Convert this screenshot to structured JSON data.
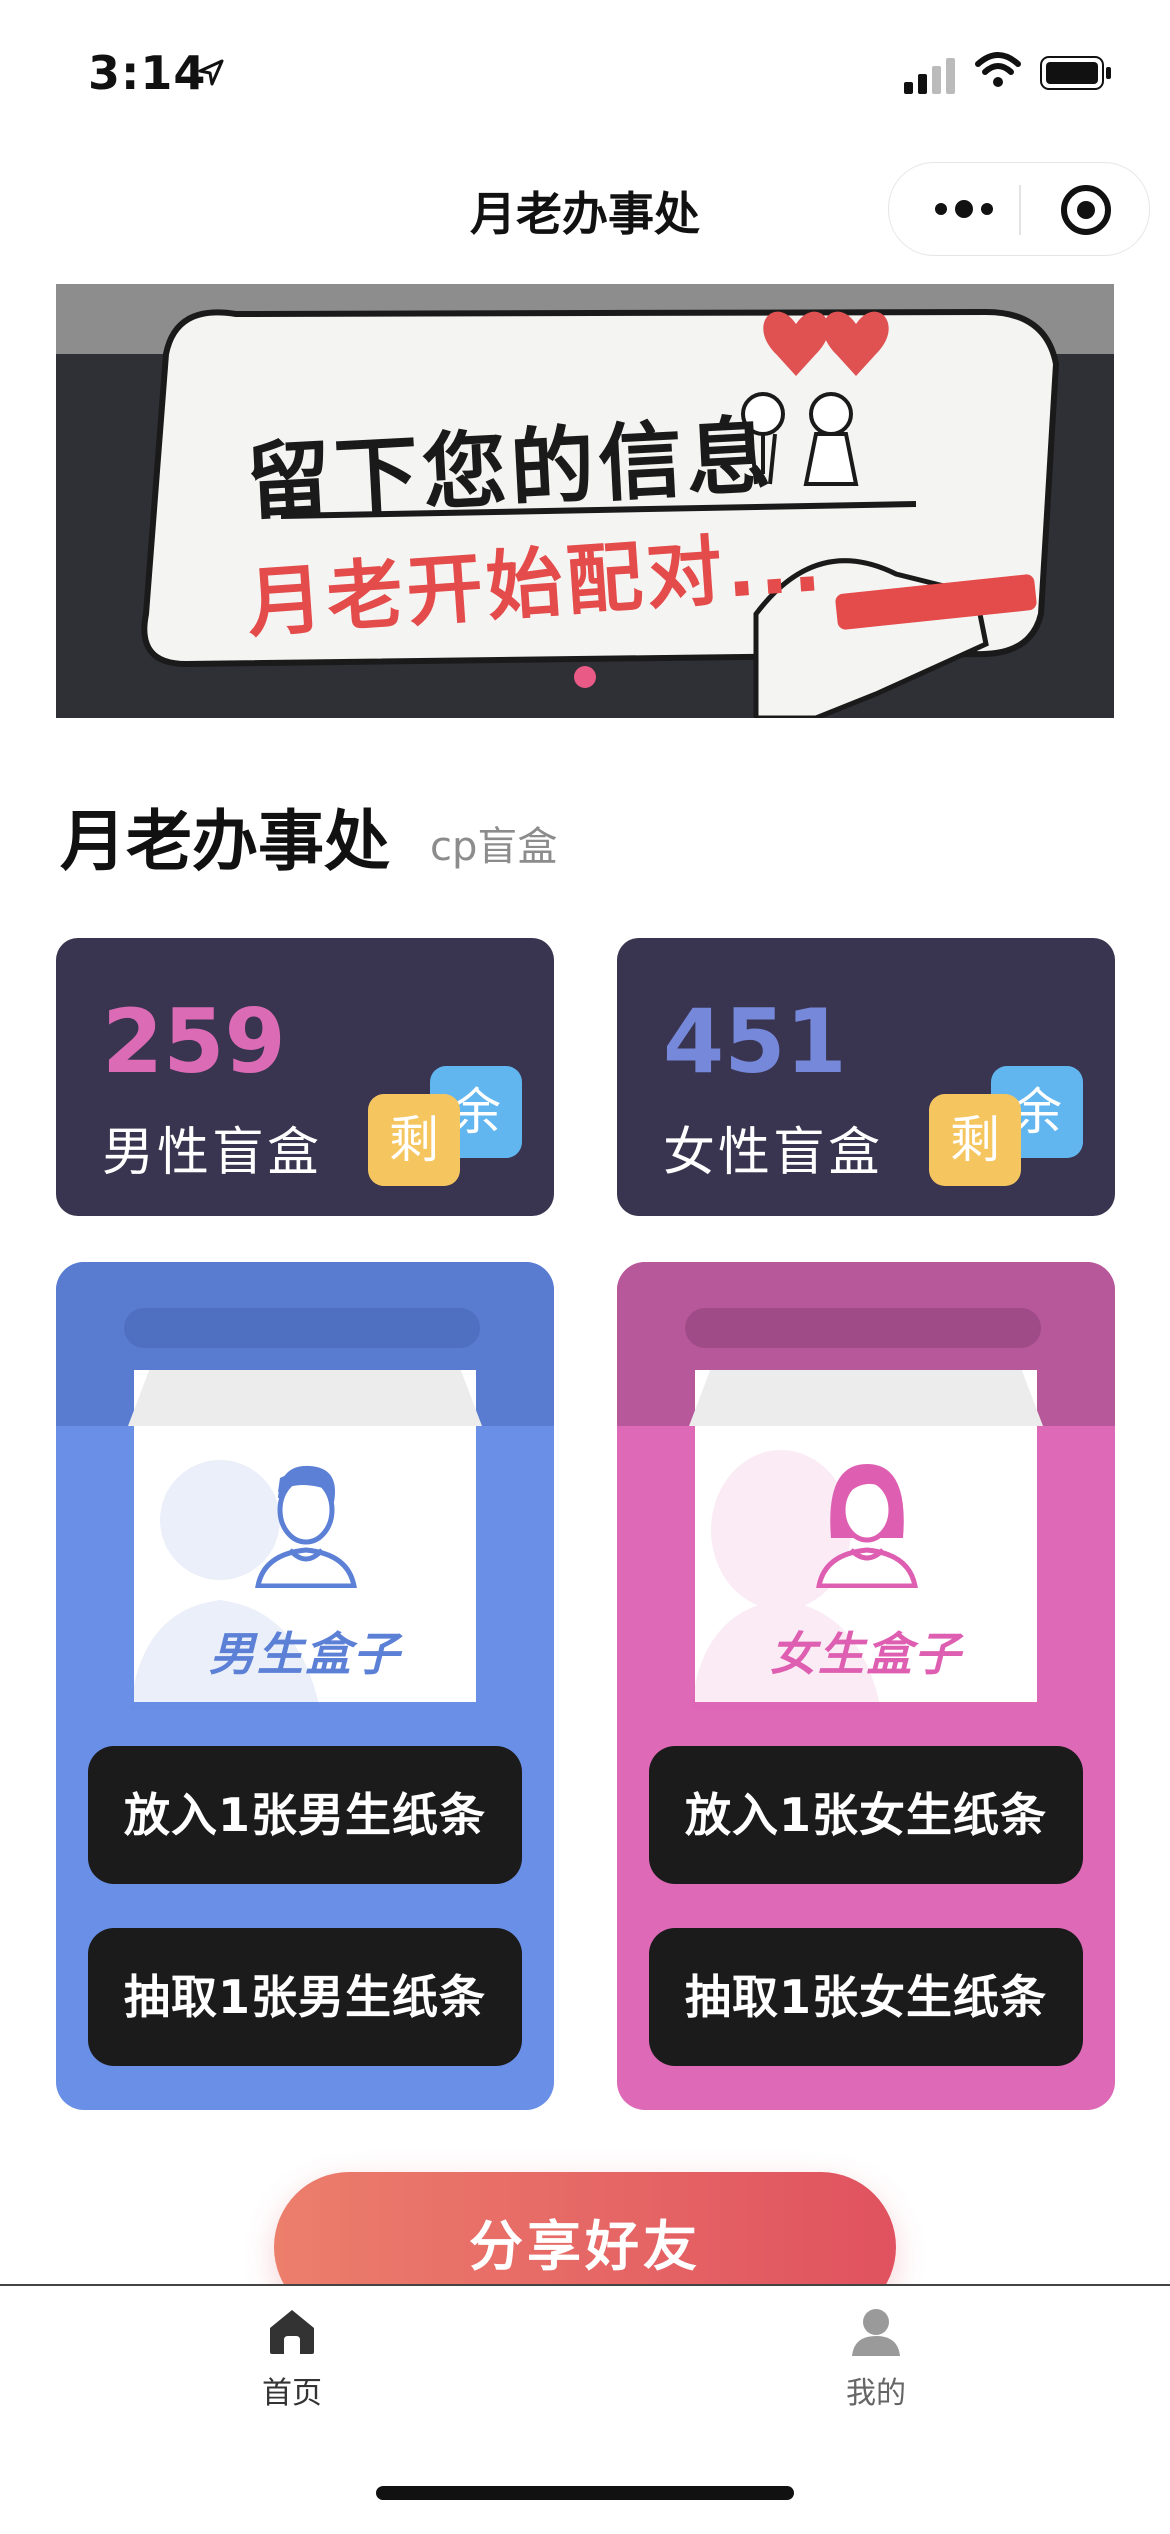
{
  "status_bar": {
    "time": "3:14"
  },
  "nav": {
    "title": "月老办事处"
  },
  "banner": {
    "line1": "留下您的信息",
    "line2": "月老开始配对..."
  },
  "section": {
    "title": "月老办事处",
    "subtitle": "cp盲盒"
  },
  "stats": [
    {
      "count": "259",
      "label": "男性盲盒",
      "tag_remaining": "剩",
      "tag_left": "余"
    },
    {
      "count": "451",
      "label": "女性盲盒",
      "tag_remaining": "剩",
      "tag_left": "余"
    }
  ],
  "boxes": [
    {
      "caption": "男生盒子",
      "put_label": "放入1张男生纸条",
      "draw_label": "抽取1张男生纸条"
    },
    {
      "caption": "女生盒子",
      "put_label": "放入1张女生纸条",
      "draw_label": "抽取1张女生纸条"
    }
  ],
  "share": {
    "label": "分享好友"
  },
  "tabbar": {
    "items": [
      {
        "label": "首页",
        "icon": "home-icon"
      },
      {
        "label": "我的",
        "icon": "user-icon"
      }
    ]
  },
  "colors": {
    "stat_card_bg": "#39344f",
    "male_accent": "#6a8fe6",
    "female_accent": "#dd69b7",
    "tag_blue": "#62b6f0",
    "tag_yellow": "#f5c660",
    "share_gradient_start": "#ec7e6c",
    "share_gradient_end": "#e0525f"
  }
}
